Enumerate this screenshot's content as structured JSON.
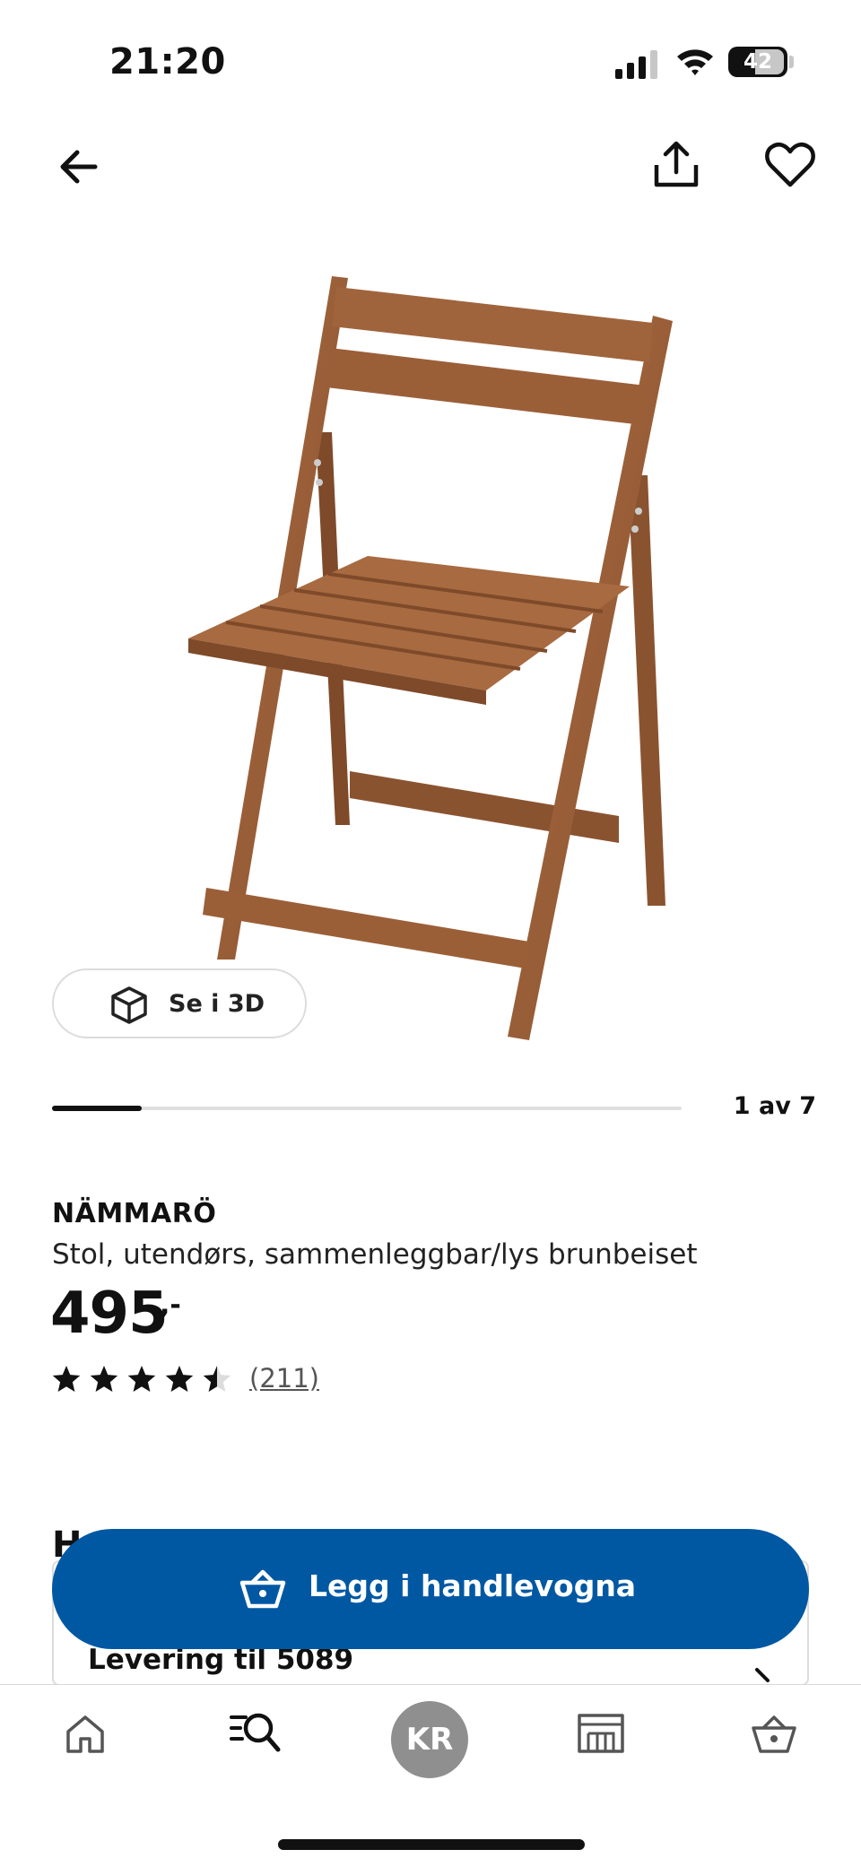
{
  "status_bar": {
    "time": "21:20",
    "battery_level": "42"
  },
  "nav": {
    "back_icon": "arrow-left-icon",
    "share_icon": "share-icon",
    "favorite_icon": "heart-icon"
  },
  "gallery": {
    "see_3d_label": "Se i 3D",
    "pager_label": "1 av 7",
    "pager_progress": 0.14285714285714285
  },
  "product": {
    "name": "NÄMMARÖ",
    "description": "Stol, utendørs, sammenleggbar/lys brunbeiset",
    "price": "495",
    "price_suffix": ",-",
    "rating": 4.5,
    "review_count": "(211)"
  },
  "section": {
    "heading_visible_fragment": "H",
    "delivery_label": "Levering til 5089"
  },
  "cta": {
    "add_to_cart_label": "Legg i handlevogna",
    "color": "#0058a3"
  },
  "tab_bar": {
    "profile_initials": "KR",
    "items": [
      "home-icon",
      "search-icon",
      "profile-avatar",
      "store-icon",
      "cart-icon"
    ]
  },
  "colors": {
    "brand_blue": "#0058a3",
    "wood": "#9a5f38"
  }
}
